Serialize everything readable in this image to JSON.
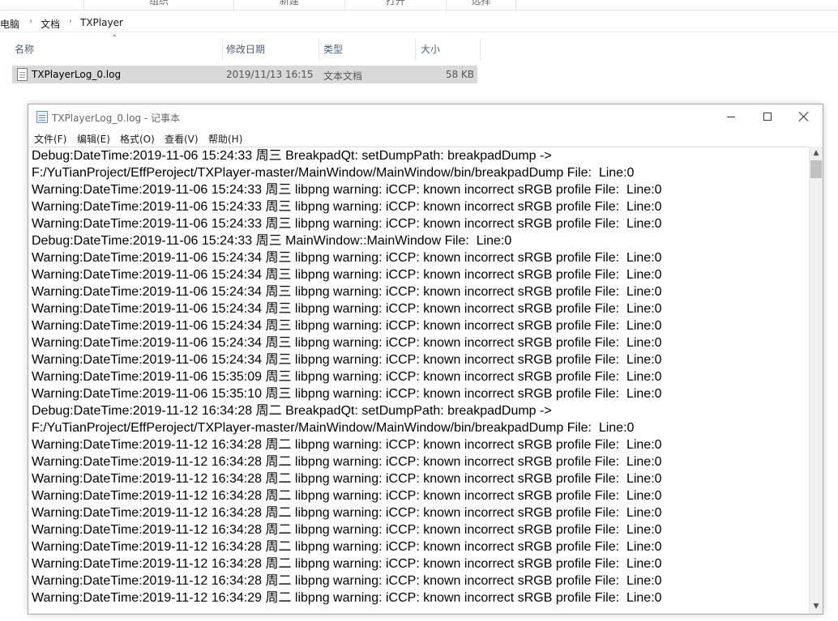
{
  "explorer": {
    "ribbon_groups": [
      "组织",
      "新建",
      "打开",
      "选择"
    ],
    "breadcrumb": [
      "电脑",
      "文档",
      "TXPlayer"
    ],
    "columns": [
      "名称",
      "修改日期",
      "类型",
      "大小"
    ],
    "files": [
      {
        "name": "TXPlayerLog_0.log",
        "date": "2019/11/13 16:15",
        "type": "文本文档",
        "size": "58 KB"
      }
    ]
  },
  "notepad": {
    "title": "TXPlayerLog_0.log - 记事本",
    "menu": [
      "文件(F)",
      "编辑(E)",
      "格式(O)",
      "查看(V)",
      "帮助(H)"
    ],
    "lines": [
      "Debug:DateTime:2019-11-06 15:24:33 周三 BreakpadQt: setDumpPath: breakpadDump ->",
      "F:/YuTianProject/EffPeroject/TXPlayer-master/MainWindow/MainWindow/bin/breakpadDump File:  Line:0",
      "Warning:DateTime:2019-11-06 15:24:33 周三 libpng warning: iCCP: known incorrect sRGB profile File:  Line:0",
      "Warning:DateTime:2019-11-06 15:24:33 周三 libpng warning: iCCP: known incorrect sRGB profile File:  Line:0",
      "Warning:DateTime:2019-11-06 15:24:33 周三 libpng warning: iCCP: known incorrect sRGB profile File:  Line:0",
      "Debug:DateTime:2019-11-06 15:24:33 周三 MainWindow::MainWindow File:  Line:0",
      "Warning:DateTime:2019-11-06 15:24:34 周三 libpng warning: iCCP: known incorrect sRGB profile File:  Line:0",
      "Warning:DateTime:2019-11-06 15:24:34 周三 libpng warning: iCCP: known incorrect sRGB profile File:  Line:0",
      "Warning:DateTime:2019-11-06 15:24:34 周三 libpng warning: iCCP: known incorrect sRGB profile File:  Line:0",
      "Warning:DateTime:2019-11-06 15:24:34 周三 libpng warning: iCCP: known incorrect sRGB profile File:  Line:0",
      "Warning:DateTime:2019-11-06 15:24:34 周三 libpng warning: iCCP: known incorrect sRGB profile File:  Line:0",
      "Warning:DateTime:2019-11-06 15:24:34 周三 libpng warning: iCCP: known incorrect sRGB profile File:  Line:0",
      "Warning:DateTime:2019-11-06 15:24:34 周三 libpng warning: iCCP: known incorrect sRGB profile File:  Line:0",
      "Warning:DateTime:2019-11-06 15:35:09 周三 libpng warning: iCCP: known incorrect sRGB profile File:  Line:0",
      "Warning:DateTime:2019-11-06 15:35:10 周三 libpng warning: iCCP: known incorrect sRGB profile File:  Line:0",
      "Debug:DateTime:2019-11-12 16:34:28 周二 BreakpadQt: setDumpPath: breakpadDump ->",
      "F:/YuTianProject/EffPeroject/TXPlayer-master/MainWindow/MainWindow/bin/breakpadDump File:  Line:0",
      "Warning:DateTime:2019-11-12 16:34:28 周二 libpng warning: iCCP: known incorrect sRGB profile File:  Line:0",
      "Warning:DateTime:2019-11-12 16:34:28 周二 libpng warning: iCCP: known incorrect sRGB profile File:  Line:0",
      "Warning:DateTime:2019-11-12 16:34:28 周二 libpng warning: iCCP: known incorrect sRGB profile File:  Line:0",
      "Warning:DateTime:2019-11-12 16:34:28 周二 libpng warning: iCCP: known incorrect sRGB profile File:  Line:0",
      "Warning:DateTime:2019-11-12 16:34:28 周二 libpng warning: iCCP: known incorrect sRGB profile File:  Line:0",
      "Warning:DateTime:2019-11-12 16:34:28 周二 libpng warning: iCCP: known incorrect sRGB profile File:  Line:0",
      "Warning:DateTime:2019-11-12 16:34:28 周二 libpng warning: iCCP: known incorrect sRGB profile File:  Line:0",
      "Warning:DateTime:2019-11-12 16:34:28 周二 libpng warning: iCCP: known incorrect sRGB profile File:  Line:0",
      "Warning:DateTime:2019-11-12 16:34:28 周二 libpng warning: iCCP: known incorrect sRGB profile File:  Line:0",
      "Warning:DateTime:2019-11-12 16:34:29 周二 libpng warning: iCCP: known incorrect sRGB profile File:  Line:0"
    ]
  },
  "colors": {
    "selected_row": "#d9d9d9",
    "column_header_text": "#4c607a",
    "scrollbar_thumb": "#c2c2c2"
  }
}
